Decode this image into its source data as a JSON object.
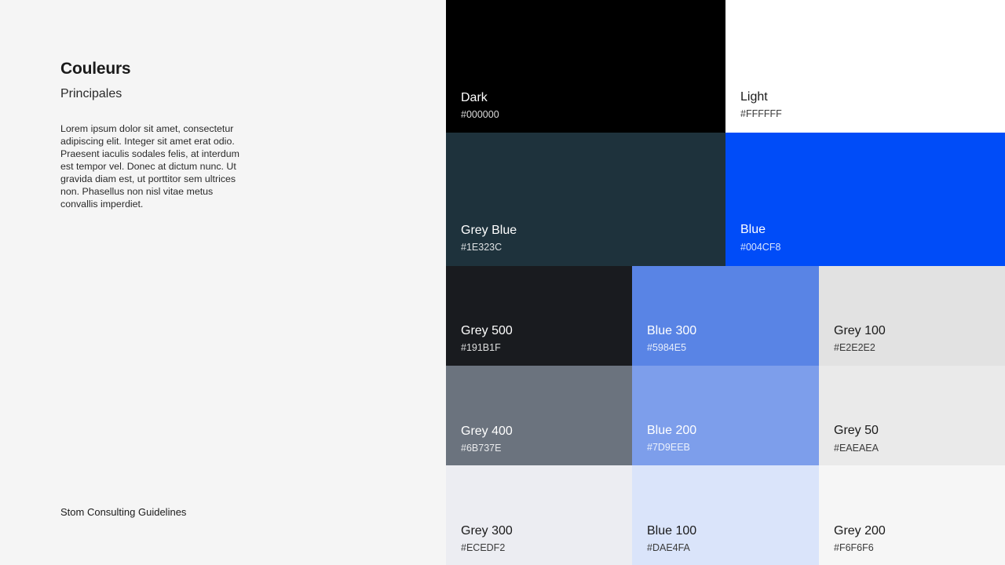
{
  "sidebar": {
    "title": "Couleurs",
    "subtitle": "Principales",
    "description": "Lorem ipsum dolor sit amet, consectetur adipiscing elit. Integer sit amet erat odio. Praesent iaculis sodales felis, at interdum est tempor vel. Donec at dictum nunc. Ut gravida diam est, ut porttitor sem ultrices non. Phasellus non nisl vitae metus convallis imperdiet.",
    "footer": "Stom Consulting Guidelines"
  },
  "swatches": [
    {
      "name": "Dark",
      "hex": "#000000",
      "color": "#000000"
    },
    {
      "name": "Light",
      "hex": "#FFFFFF",
      "color": "#FFFFFF"
    },
    {
      "name": "Grey Blue",
      "hex": "#1E323C",
      "color": "#1E323C"
    },
    {
      "name": "Blue",
      "hex": "#004CF8",
      "color": "#004CF8"
    },
    {
      "name": "Grey 500",
      "hex": "#191B1F",
      "color": "#191B1F"
    },
    {
      "name": "Blue 300",
      "hex": "#5984E5",
      "color": "#5984E5"
    },
    {
      "name": "Grey 100",
      "hex": "#E2E2E2",
      "color": "#E2E2E2"
    },
    {
      "name": "Grey 400",
      "hex": "#6B737E",
      "color": "#6B737E"
    },
    {
      "name": "Blue 200",
      "hex": "#7D9EEB",
      "color": "#7D9EEB"
    },
    {
      "name": "Grey 50",
      "hex": "#EAEAEA",
      "color": "#EAEAEA"
    },
    {
      "name": "Grey 300",
      "hex": "#ECEDF2",
      "color": "#ECEDF2"
    },
    {
      "name": "Blue 100",
      "hex": "#DAE4FA",
      "color": "#DAE4FA"
    },
    {
      "name": "Grey 200",
      "hex": "#F6F6F6",
      "color": "#F6F6F6"
    }
  ]
}
